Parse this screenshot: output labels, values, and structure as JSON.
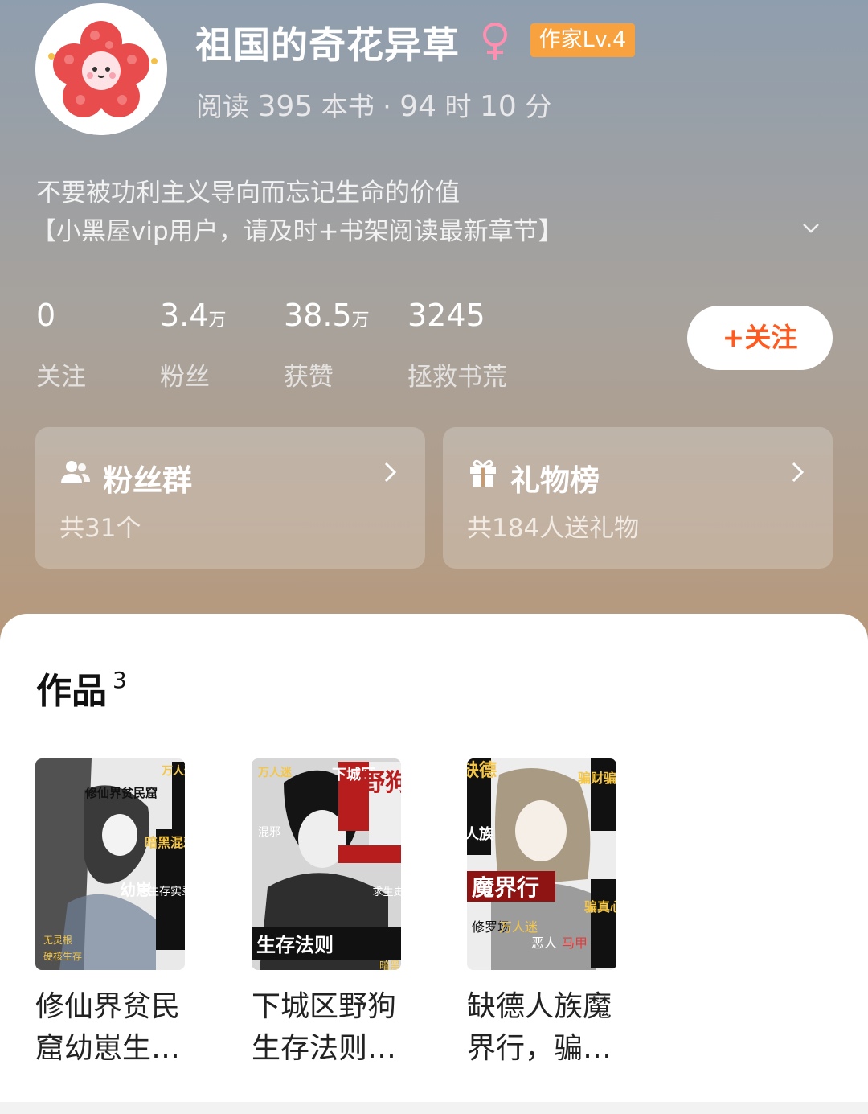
{
  "profile": {
    "username": "祖国的奇花异草",
    "gender_symbol": "♀",
    "level_badge": "作家Lv.4",
    "reading_prefix": "阅读",
    "books_read": "395",
    "books_unit": "本书",
    "separator": "·",
    "hours": "94",
    "hours_unit": "时",
    "minutes": "10",
    "minutes_unit": "分",
    "bio_line1": "不要被功利主义导向而忘记生命的价值",
    "bio_line2": "【小黑屋vip用户，请及时+书架阅读最新章节】"
  },
  "stats": [
    {
      "value": "0",
      "unit": "",
      "label": "关注"
    },
    {
      "value": "3.4",
      "unit": "万",
      "label": "粉丝"
    },
    {
      "value": "38.5",
      "unit": "万",
      "label": "获赞"
    },
    {
      "value": "3245",
      "unit": "",
      "label": "拯救书荒"
    }
  ],
  "follow_button": "+关注",
  "cards": {
    "fan_group": {
      "title": "粉丝群",
      "subtitle": "共31个"
    },
    "gift_rank": {
      "title": "礼物榜",
      "subtitle": "共184人送礼物"
    }
  },
  "works": {
    "title": "作品",
    "count": "3",
    "books": [
      {
        "name_line1": "修仙界贫民",
        "name_line2": "窟幼崽生…",
        "cover_text": [
          "万人迷",
          "暗黑混邪",
          "修仙界贫民窟",
          "幼崽",
          "生存实录",
          "无灵根",
          "硬核生存"
        ]
      },
      {
        "name_line1": "下城区野狗",
        "name_line2": "生存法则…",
        "cover_text": [
          "下城区",
          "野狗",
          "万人迷",
          "混邪",
          "生存法则",
          "求生史",
          "暗黑"
        ]
      },
      {
        "name_line1": "缺德人族魔",
        "name_line2": "界行，骗…",
        "cover_text": [
          "缺德",
          "人族",
          "魔界行",
          "骗财骗色",
          "骗真心",
          "修罗场",
          "万人迷",
          "恶人",
          "马甲"
        ]
      }
    ]
  },
  "colors": {
    "accent": "#ff5a1f",
    "badge": "#f7a23f",
    "gender": "#ff8fb0"
  }
}
